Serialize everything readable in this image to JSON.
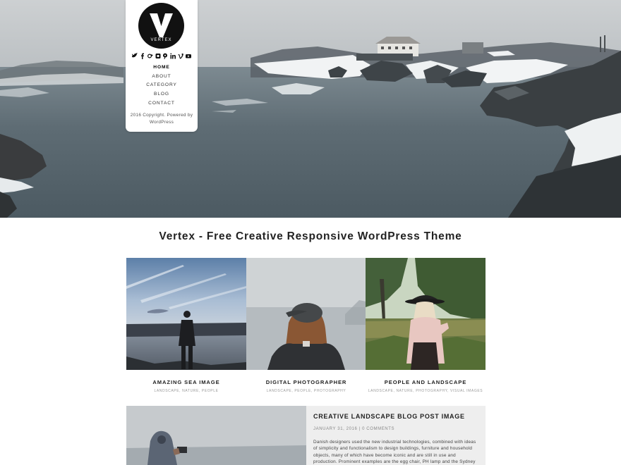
{
  "sidebar": {
    "logo_letter": "V",
    "logo_text": "VERTEX",
    "social_icons": [
      "twitter-icon",
      "facebook-icon",
      "google-plus-icon",
      "instagram-icon",
      "pinterest-icon",
      "linkedin-icon",
      "vimeo-icon",
      "youtube-icon"
    ],
    "nav": [
      {
        "label": "HOME"
      },
      {
        "label": "ABOUT"
      },
      {
        "label": "CATEGORY"
      },
      {
        "label": "BLOG"
      },
      {
        "label": "CONTACT"
      }
    ],
    "copyright": "2016 Copyright. Powered by WordPress"
  },
  "main": {
    "title": "Vertex - Free Creative Responsive WordPress Theme",
    "cards": [
      {
        "title": "AMAZING SEA IMAGE",
        "tags": "LANDSCAPE, NATURE, PEOPLE"
      },
      {
        "title": "DIGITAL PHOTOGRAPHER",
        "tags": "LANDSCAPE, PEOPLE, PHOTOGRAPHY"
      },
      {
        "title": "PEOPLE AND LANDSCAPE",
        "tags": "LANDSCAPE, NATURE, PHOTOGRAPHY, VISUAL IMAGES"
      }
    ],
    "post": {
      "title": "CREATIVE LANDSCAPE BLOG POST IMAGE",
      "meta": "JANUARY 31, 2016 | 0 COMMENTS",
      "excerpt": "Danish designers used the new industrial technologies, combined with ideas of simplicity and functionalism to design buildings, furniture and household objects, many of which have become iconic and are still in use and production. Prominent examples are the egg chair, PH lamp and the Sydney Opera House Danish"
    }
  },
  "colors": {
    "accent": "#111111",
    "post_background": "#eeeeee",
    "tag_text": "#999999"
  }
}
